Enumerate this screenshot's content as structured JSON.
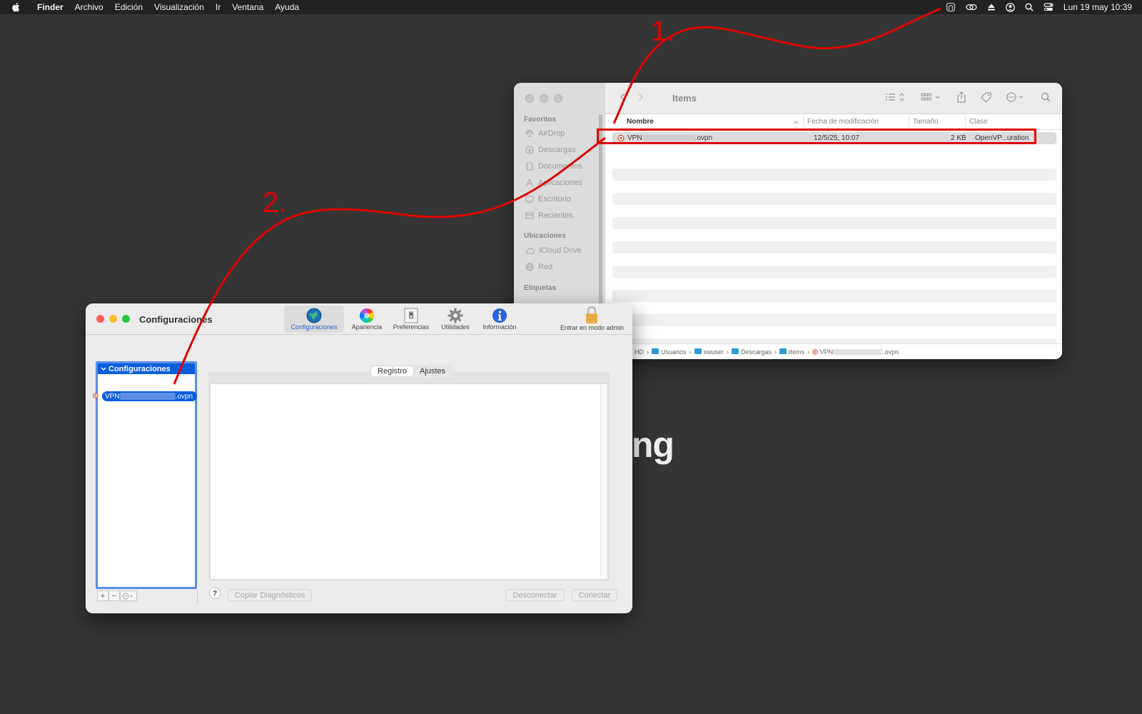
{
  "menubar": {
    "items": [
      "Finder",
      "Archivo",
      "Edición",
      "Visualización",
      "Ir",
      "Ventana",
      "Ayuda"
    ],
    "clock": "Lun 19 may  10:39",
    "status_icons": [
      "tunnelblick-icon",
      "link-icon",
      "eject-icon",
      "user-icon",
      "search-icon",
      "control-center-icon"
    ]
  },
  "background_text": "ing",
  "finder": {
    "title": "Items",
    "sidebar": {
      "favorites_label": "Favoritos",
      "favorites": [
        "AirDrop",
        "Descargas",
        "Documentos",
        "Aplicaciones",
        "Escritorio",
        "Recientes"
      ],
      "locations_label": "Ubicaciones",
      "locations": [
        "iCloud Drive",
        "Red"
      ],
      "tags_label": "Etiquetas"
    },
    "columns": {
      "name": "Nombre",
      "modified": "Fecha de modificación",
      "size": "Tamaño",
      "kind": "Clase"
    },
    "file": {
      "name_prefix": "VPN",
      "name_suffix": ".ovpn",
      "modified": "12/5/25, 10:07",
      "size": "2 KB",
      "kind": "OpenVP...uration"
    },
    "pathbar": {
      "disk": "cintosh HD",
      "folders": [
        "Usuarios",
        "swuser",
        "Descargas",
        "Items"
      ],
      "file_prefix": "VPN",
      "file_suffix": ".ovpn"
    }
  },
  "tunnelblick": {
    "title": "Configuraciones",
    "tabs": [
      "Configuraciones",
      "Apariencia",
      "Preferencias",
      "Utilidades",
      "Información"
    ],
    "lock_label": "Entrar en modo admin",
    "list_header": "Configuraciones",
    "config_item_prefix": "VPN",
    "config_item_suffix": ".ovpn",
    "segments": [
      "Registro",
      "Ajustes"
    ],
    "help": "?",
    "copy_diag": "Copiar Diagnósticos",
    "disconnect": "Desconectar",
    "connect": "Conectar",
    "list_plus": "+",
    "list_minus": "−"
  },
  "annotations": {
    "step1": "1.",
    "step2": "2.",
    "color": "#e00000"
  }
}
